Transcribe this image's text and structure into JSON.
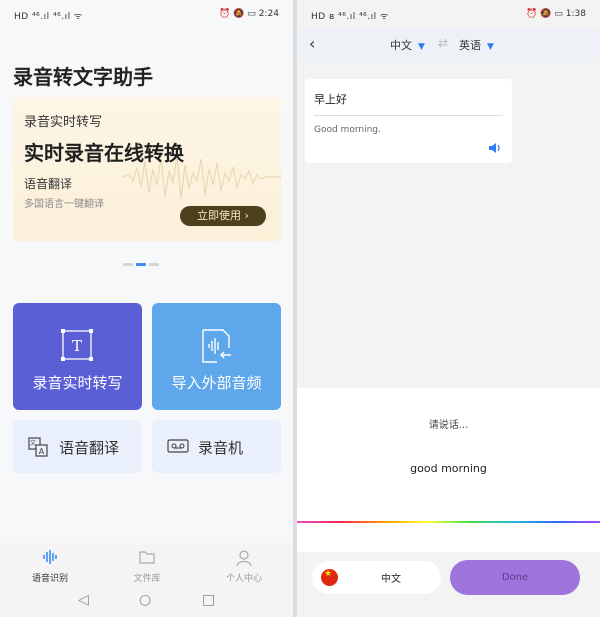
{
  "left": {
    "status": {
      "left": "HD ⁴⁶.ıl ⁴⁶.ıl ᯤ",
      "right": "⏰ 🔕 ▭ 2:24"
    },
    "app_title": "录音转文字助手",
    "banner": {
      "line1": "录音实时转写",
      "line2": "实时录音在线转换",
      "line3": "语音翻译",
      "line4": "多国语言一键翻译",
      "button": "立即使用 ›"
    },
    "cards": {
      "transcribe": "录音实时转写",
      "import_audio": "导入外部音频",
      "translate": "语音翻译",
      "recorder": "录音机"
    },
    "nav": {
      "speech": "语音识别",
      "files": "文件库",
      "profile": "个人中心"
    }
  },
  "right": {
    "status": {
      "left": "HD ʙ ⁴⁶.ıl ⁴⁶.ıl ᯤ",
      "right": "⏰ 🔕 ▭ 1:38"
    },
    "source_lang": "中文",
    "target_lang": "英语",
    "result": {
      "source_text": "早上好",
      "translated_text": "Good morning."
    },
    "listen_hint": "请说话...",
    "recognized_text": "good morning",
    "bottom_lang": "中文",
    "done_label": "Done"
  },
  "colors": {
    "transcribe_card": "#5b5fd6",
    "import_card": "#5ea7ea",
    "accent_blue": "#2f7ef0",
    "done_button": "#9e75dc",
    "banner_button": "#4d3f1c"
  }
}
